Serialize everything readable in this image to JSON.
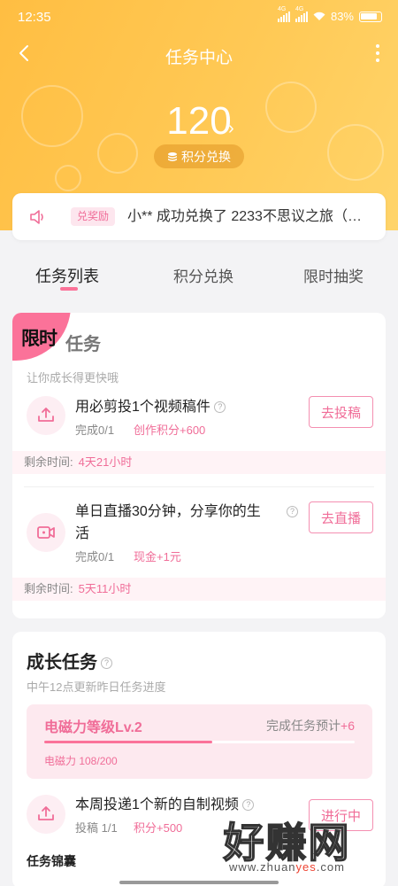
{
  "status_bar": {
    "time": "12:35",
    "signal1": "4G",
    "signal2": "4G",
    "battery": "83%"
  },
  "header": {
    "title": "任务中心",
    "points": "120",
    "points_arrow": "›",
    "exchange_button": "积分兑换"
  },
  "notice": {
    "badge": "兑奖励",
    "text": "小** 成功兑换了 2233不思议之旅（…"
  },
  "tabs": [
    {
      "label": "任务列表",
      "active": true
    },
    {
      "label": "积分兑换",
      "active": false
    },
    {
      "label": "限时抽奖",
      "active": false
    }
  ],
  "limited_section": {
    "corner_label": "限时",
    "title": "任务",
    "subtitle": "让你成长得更快哦",
    "tasks": [
      {
        "name": "用必剪投1个视频稿件",
        "progress": "完成0/1",
        "reward": "创作积分+600",
        "button": "去投稿",
        "remain_label": "剩余时间:",
        "remain_value": "4天21小时",
        "icon": "upload-icon"
      },
      {
        "name_line1": "单日直播30分钟，分享你的生",
        "name_line2": "活",
        "progress": "完成0/1",
        "reward": "现金+1元",
        "button": "去直播",
        "remain_label": "剩余时间:",
        "remain_value": "5天11小时",
        "icon": "live-video-icon"
      }
    ]
  },
  "growth_section": {
    "title": "成长任务",
    "subtitle": "中午12点更新昨日任务进度",
    "level": {
      "title": "电磁力等级Lv.2",
      "predict_label": "完成任务预计",
      "predict_value": "+6",
      "progress_text": "电磁力 108/200",
      "current": 108,
      "max": 200
    },
    "task": {
      "name": "本周投递1个新的自制视频",
      "progress": "投稿 1/1",
      "reward": "积分+500",
      "button": "进行中",
      "icon": "upload-icon"
    },
    "bag_title": "任务锦囊"
  },
  "watermark": {
    "main": "好赚网",
    "site_prefix": "www.zhuan",
    "site_highlight": "yes",
    "site_suffix": ".com"
  },
  "colors": {
    "accent": "#fb7299",
    "header": "#ffc34a",
    "reward": "#f06d98"
  }
}
